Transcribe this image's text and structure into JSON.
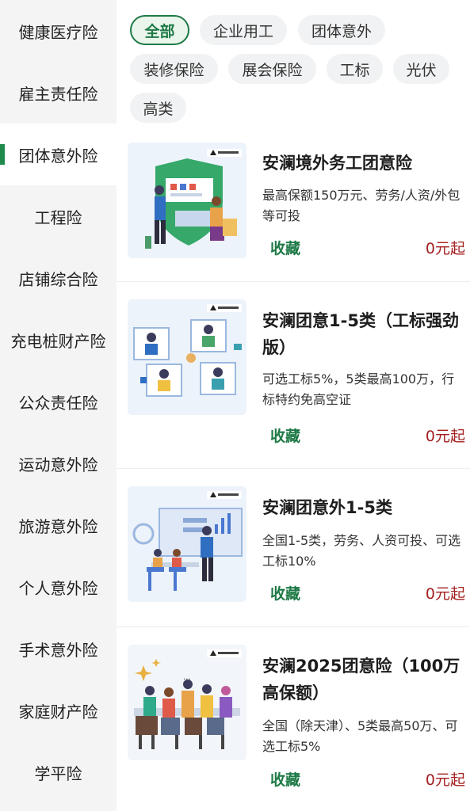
{
  "sidebar": {
    "items": [
      {
        "label": "健康医疗险"
      },
      {
        "label": "雇主责任险"
      },
      {
        "label": "团体意外险",
        "active": true
      },
      {
        "label": "工程险"
      },
      {
        "label": "店铺综合险"
      },
      {
        "label": "充电桩财产险"
      },
      {
        "label": "公众责任险"
      },
      {
        "label": "运动意外险"
      },
      {
        "label": "旅游意外险"
      },
      {
        "label": "个人意外险"
      },
      {
        "label": "手术意外险"
      },
      {
        "label": "家庭财产险"
      },
      {
        "label": "学平险"
      }
    ]
  },
  "filters": {
    "tags": [
      {
        "label": "全部",
        "active": true
      },
      {
        "label": "企业用工"
      },
      {
        "label": "团体意外"
      },
      {
        "label": "装修保险"
      },
      {
        "label": "展会保险"
      },
      {
        "label": "工标"
      },
      {
        "label": "光伏"
      },
      {
        "label": "高类"
      }
    ]
  },
  "products": [
    {
      "title": "安澜境外务工团意险",
      "desc": "最高保额150万元、劳务/人资/外包等可投",
      "fav": "收藏",
      "price": "0元起",
      "image_icon": "shield-office-illustration"
    },
    {
      "title": "安澜团意1-5类（工标强劲版）",
      "desc": "可选工标5%，5类最高100万，行标特约免高空证",
      "fav": "收藏",
      "price": "0元起",
      "image_icon": "video-call-illustration"
    },
    {
      "title": "安澜团意外1-5类",
      "desc": "全国1-5类，劳务、人资可投、可选工标10%",
      "fav": "收藏",
      "price": "0元起",
      "image_icon": "team-meeting-illustration"
    },
    {
      "title": "安澜2025团意险（100万高保额）",
      "desc": "全国（除天津）、5类最高50万、可选工标5%",
      "fav": "收藏",
      "price": "0元起",
      "image_icon": "team-celebration-illustration"
    }
  ],
  "colors": {
    "accent_green": "#1e7a46",
    "price_red": "#a31f1f",
    "sidebar_bg": "#f4f4f4"
  }
}
